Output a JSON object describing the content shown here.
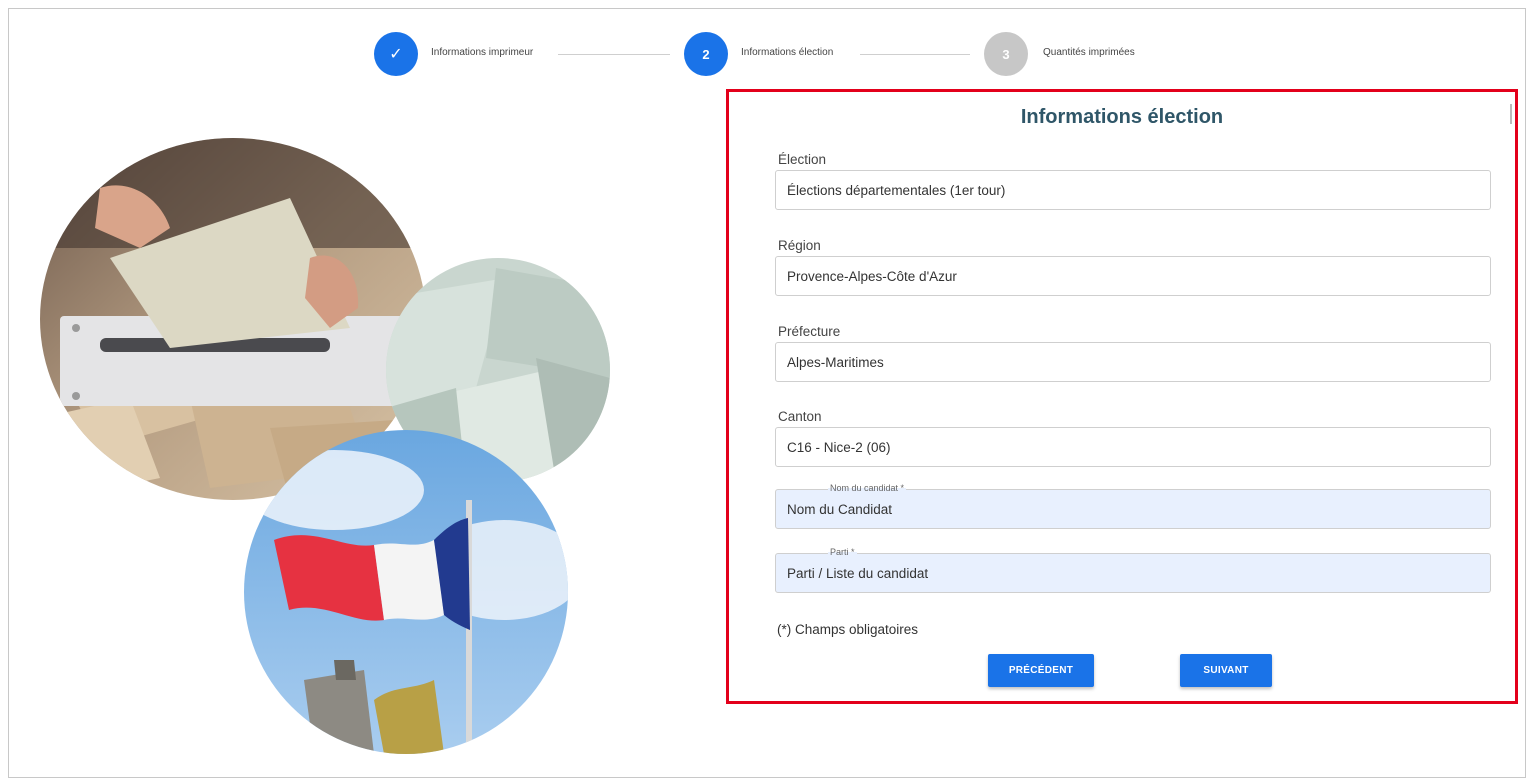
{
  "stepper": {
    "steps": [
      {
        "number": "1",
        "label": "Informations imprimeur",
        "state": "done"
      },
      {
        "number": "2",
        "label": "Informations élection",
        "state": "active"
      },
      {
        "number": "3",
        "label": "Quantités imprimées",
        "state": "pending"
      }
    ],
    "check_glyph": "✓"
  },
  "form": {
    "title": "Informations élection",
    "fields": [
      {
        "label": "Élection",
        "value": "Élections départementales (1er tour)"
      },
      {
        "label": "Région",
        "value": "Provence-Alpes-Côte d'Azur"
      },
      {
        "label": "Préfecture",
        "value": "Alpes-Maritimes"
      },
      {
        "label": "Canton",
        "value": "C16 - Nice-2 (06)"
      }
    ],
    "candidate": {
      "label": "Nom du candidat *",
      "value": "Nom du Candidat"
    },
    "party": {
      "label": "Parti *",
      "value": "Parti / Liste du candidat"
    },
    "required_note": "(*) Champs obligatoires",
    "prev_label": "PRÉCÉDENT",
    "next_label": "SUIVANT"
  },
  "colors": {
    "accent": "#1a73e8",
    "title": "#2f5668",
    "highlight_border": "#e3001b",
    "pending_step": "#c7c7c7",
    "filled_field": "#e8f0fe"
  }
}
